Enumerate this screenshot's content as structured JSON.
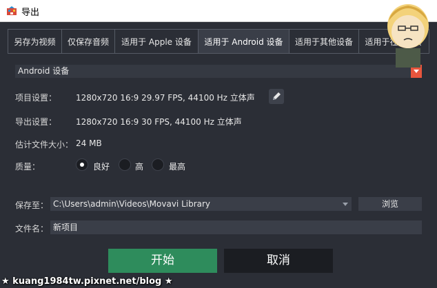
{
  "window": {
    "title": "导出"
  },
  "tabs": [
    {
      "label": "另存为视频"
    },
    {
      "label": "仅保存音频"
    },
    {
      "label": "适用于 Apple 设备"
    },
    {
      "label": "适用于 Android 设备"
    },
    {
      "label": "适用于其他设备"
    },
    {
      "label": "适用于在线上传"
    }
  ],
  "active_tab_index": 3,
  "preset": {
    "value": "Android 设备"
  },
  "project_settings": {
    "label": "项目设置：",
    "value": "1280x720 16:9 29.97 FPS, 44100 Hz 立体声"
  },
  "export_settings": {
    "label": "导出设置：",
    "value": "1280x720 16:9 30 FPS, 44100 Hz 立体声"
  },
  "file_size": {
    "label": "估计文件大小：",
    "value": "24 MB"
  },
  "quality": {
    "label": "质量：",
    "options": [
      {
        "label": "良好",
        "selected": true
      },
      {
        "label": "高",
        "selected": false
      },
      {
        "label": "最高",
        "selected": false
      }
    ]
  },
  "save_to": {
    "label": "保存至：",
    "value": "C:\\Users\\admin\\Videos\\Movavi Library",
    "browse_label": "浏览"
  },
  "file_name": {
    "label": "文件名：",
    "value": "新项目"
  },
  "buttons": {
    "start": "开始",
    "cancel": "取消"
  },
  "watermark": {
    "text": "★ kuang1984tw.pixnet.net/blog ★"
  },
  "colors": {
    "background": "#2b2e36",
    "start_button": "#2e8c5c",
    "accent": "#e8553d"
  }
}
